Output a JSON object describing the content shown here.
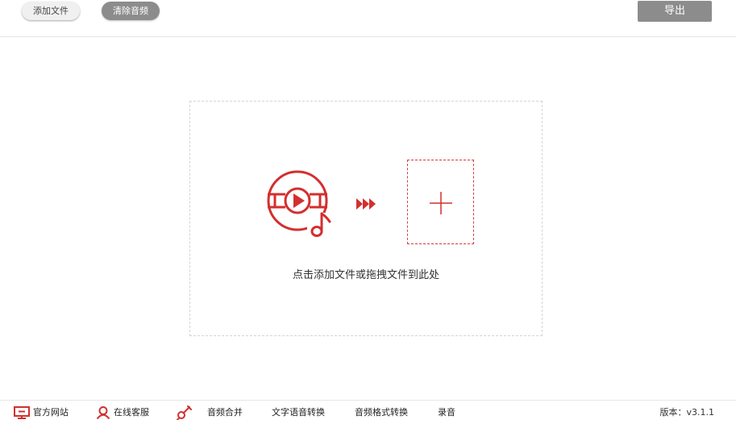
{
  "toolbar": {
    "add_file_label": "添加文件",
    "clear_audio_label": "清除音频",
    "export_label": "导出"
  },
  "dropzone": {
    "hint": "点击添加文件或拖拽文件到此处"
  },
  "footer": {
    "items": [
      {
        "label": "官方网站",
        "icon": "monitor-icon"
      },
      {
        "label": "在线客服",
        "icon": "user-icon"
      },
      {
        "label": "音频合并",
        "icon": "guitar-icon"
      },
      {
        "label": "文字语音转换"
      },
      {
        "label": "音频格式转换"
      },
      {
        "label": "录音"
      }
    ],
    "version": "版本：v3.1.1"
  },
  "colors": {
    "accent": "#d32f2f",
    "button_gray": "#8c8c8c"
  }
}
